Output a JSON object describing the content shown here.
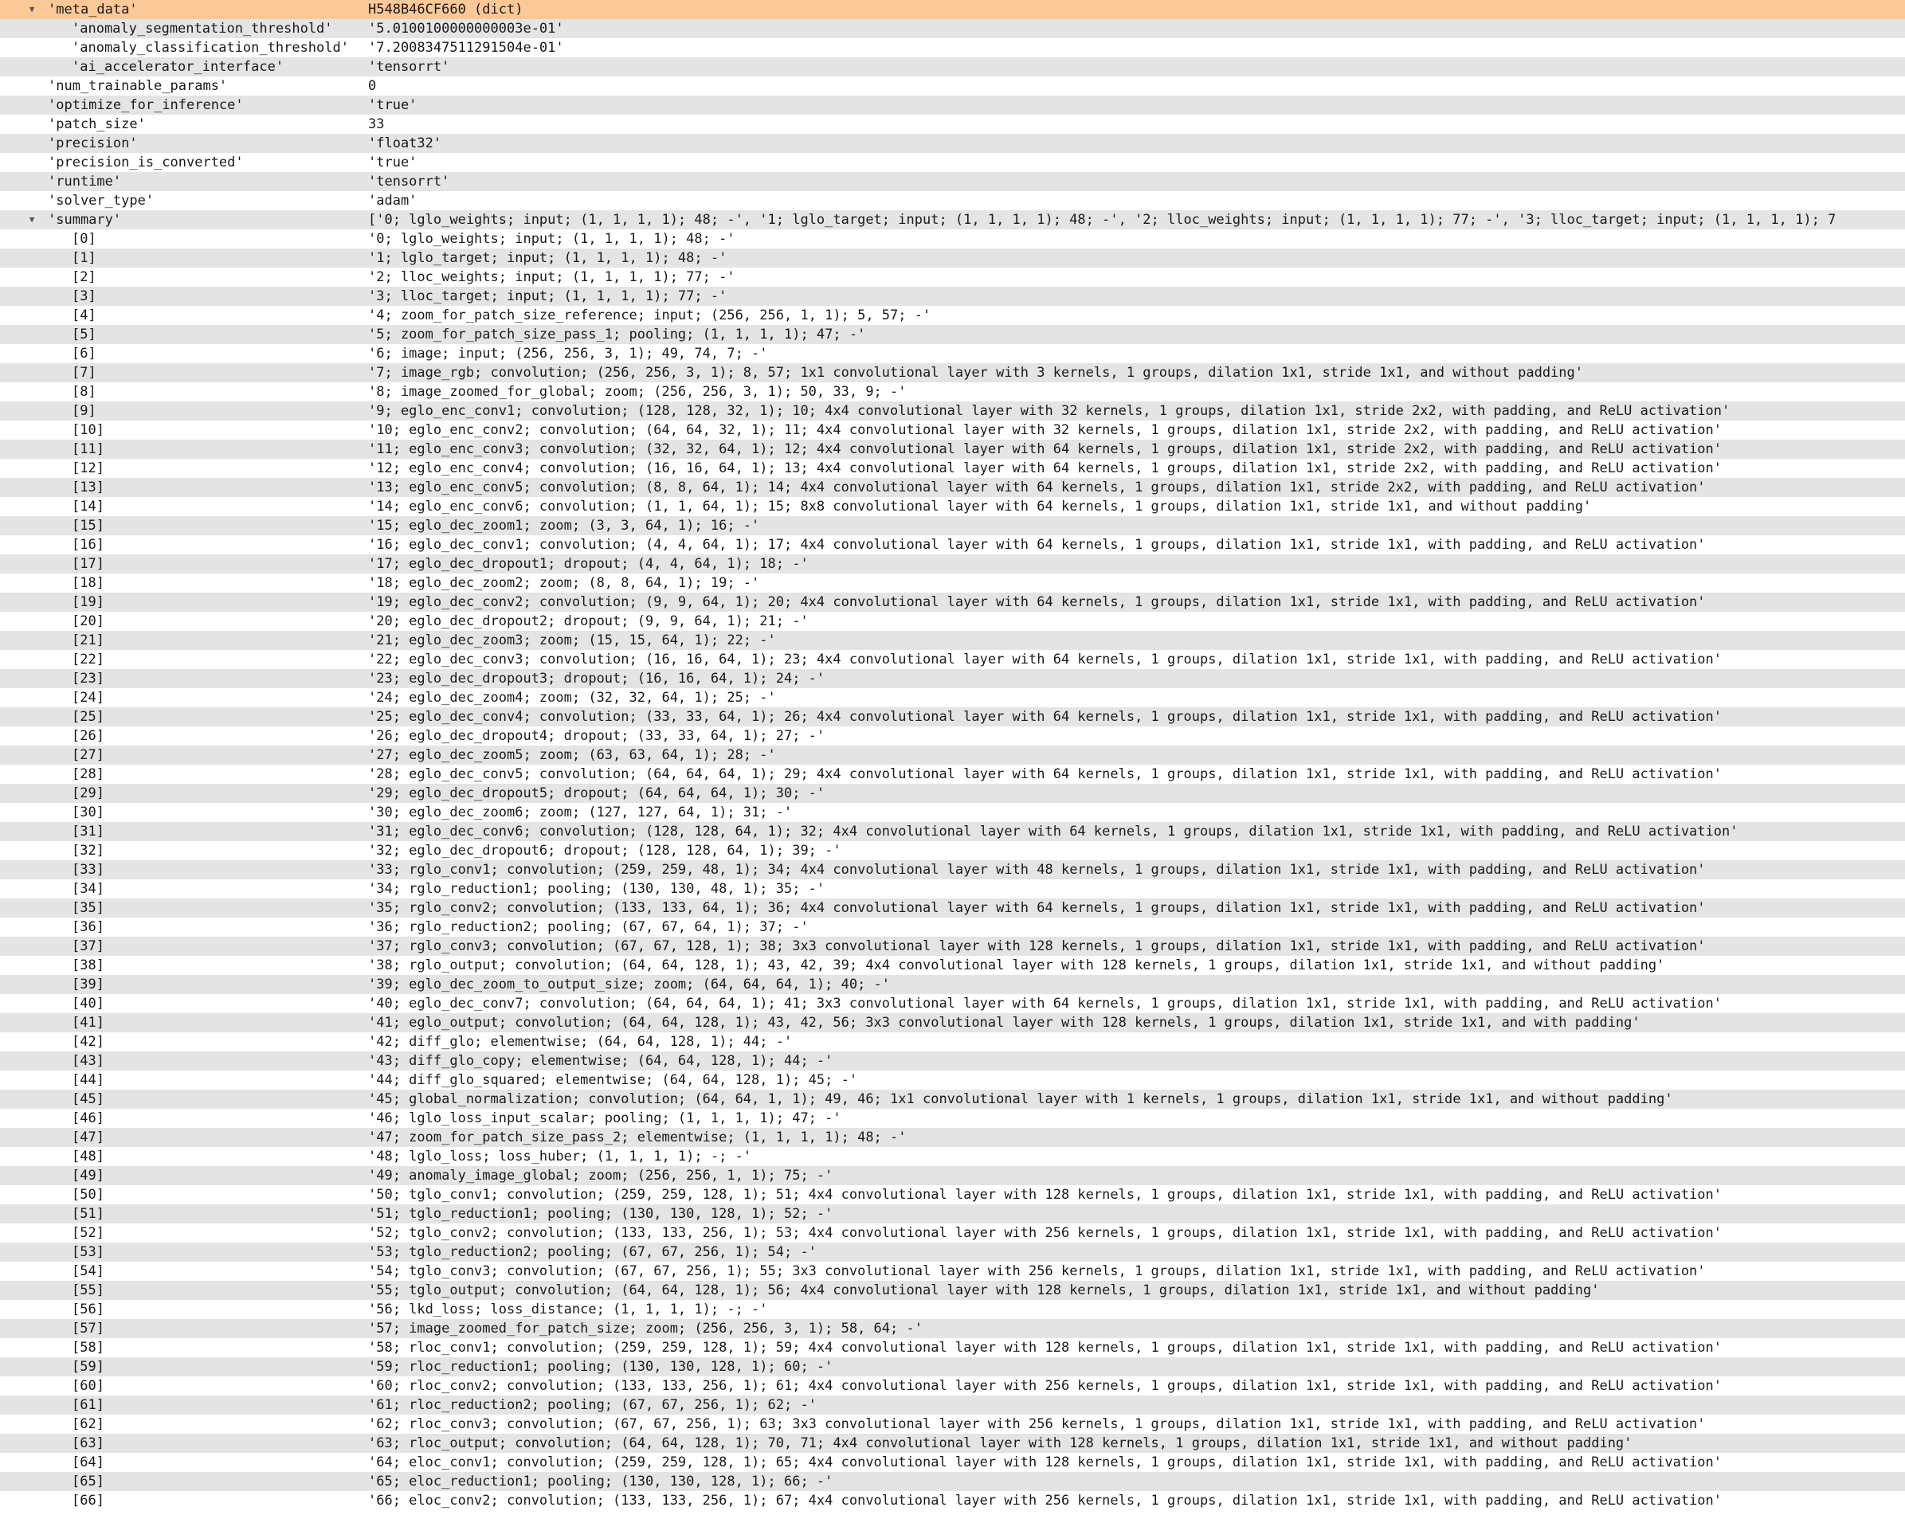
{
  "tree": {
    "rows": [
      {
        "key": "'meta_data'",
        "value": "H548B46CF660 (dict)",
        "depth": 0,
        "toggle": "expanded",
        "selected": true
      },
      {
        "key": "'anomaly_segmentation_threshold'",
        "value": "'5.0100100000000003e-01'",
        "depth": 1
      },
      {
        "key": "'anomaly_classification_threshold'",
        "value": "'7.2008347511291504e-01'",
        "depth": 1
      },
      {
        "key": "'ai_accelerator_interface'",
        "value": "'tensorrt'",
        "depth": 1
      },
      {
        "key": "'num_trainable_params'",
        "value": "0",
        "depth": 0
      },
      {
        "key": "'optimize_for_inference'",
        "value": "'true'",
        "depth": 0
      },
      {
        "key": "'patch_size'",
        "value": "33",
        "depth": 0
      },
      {
        "key": "'precision'",
        "value": "'float32'",
        "depth": 0
      },
      {
        "key": "'precision_is_converted'",
        "value": "'true'",
        "depth": 0
      },
      {
        "key": "'runtime'",
        "value": "'tensorrt'",
        "depth": 0
      },
      {
        "key": "'solver_type'",
        "value": "'adam'",
        "depth": 0
      },
      {
        "key": "'summary'",
        "value": "['0; lglo_weights; input; (1, 1, 1, 1); 48; -', '1; lglo_target; input; (1, 1, 1, 1); 48; -', '2; lloc_weights; input; (1, 1, 1, 1); 77; -', '3; lloc_target; input; (1, 1, 1, 1); 7",
        "depth": 0,
        "toggle": "expanded"
      },
      {
        "key": "[0]",
        "value": "'0; lglo_weights; input; (1, 1, 1, 1); 48; -'",
        "depth": 2
      },
      {
        "key": "[1]",
        "value": "'1; lglo_target; input; (1, 1, 1, 1); 48; -'",
        "depth": 2
      },
      {
        "key": "[2]",
        "value": "'2; lloc_weights; input; (1, 1, 1, 1); 77; -'",
        "depth": 2
      },
      {
        "key": "[3]",
        "value": "'3; lloc_target; input; (1, 1, 1, 1); 77; -'",
        "depth": 2
      },
      {
        "key": "[4]",
        "value": "'4; zoom_for_patch_size_reference; input; (256, 256, 1, 1); 5, 57; -'",
        "depth": 2
      },
      {
        "key": "[5]",
        "value": "'5; zoom_for_patch_size_pass_1; pooling; (1, 1, 1, 1); 47; -'",
        "depth": 2
      },
      {
        "key": "[6]",
        "value": "'6; image; input; (256, 256, 3, 1); 49, 74, 7; -'",
        "depth": 2
      },
      {
        "key": "[7]",
        "value": "'7; image_rgb; convolution; (256, 256, 3, 1); 8, 57; 1x1 convolutional layer with 3 kernels, 1 groups, dilation 1x1, stride 1x1, and without padding'",
        "depth": 2
      },
      {
        "key": "[8]",
        "value": "'8; image_zoomed_for_global; zoom; (256, 256, 3, 1); 50, 33, 9; -'",
        "depth": 2
      },
      {
        "key": "[9]",
        "value": "'9; eglo_enc_conv1; convolution; (128, 128, 32, 1); 10; 4x4 convolutional layer with 32 kernels, 1 groups, dilation 1x1, stride 2x2, with padding, and ReLU activation'",
        "depth": 2
      },
      {
        "key": "[10]",
        "value": "'10; eglo_enc_conv2; convolution; (64, 64, 32, 1); 11; 4x4 convolutional layer with 32 kernels, 1 groups, dilation 1x1, stride 2x2, with padding, and ReLU activation'",
        "depth": 2
      },
      {
        "key": "[11]",
        "value": "'11; eglo_enc_conv3; convolution; (32, 32, 64, 1); 12; 4x4 convolutional layer with 64 kernels, 1 groups, dilation 1x1, stride 2x2, with padding, and ReLU activation'",
        "depth": 2
      },
      {
        "key": "[12]",
        "value": "'12; eglo_enc_conv4; convolution; (16, 16, 64, 1); 13; 4x4 convolutional layer with 64 kernels, 1 groups, dilation 1x1, stride 2x2, with padding, and ReLU activation'",
        "depth": 2
      },
      {
        "key": "[13]",
        "value": "'13; eglo_enc_conv5; convolution; (8, 8, 64, 1); 14; 4x4 convolutional layer with 64 kernels, 1 groups, dilation 1x1, stride 2x2, with padding, and ReLU activation'",
        "depth": 2
      },
      {
        "key": "[14]",
        "value": "'14; eglo_enc_conv6; convolution; (1, 1, 64, 1); 15; 8x8 convolutional layer with 64 kernels, 1 groups, dilation 1x1, stride 1x1, and without padding'",
        "depth": 2
      },
      {
        "key": "[15]",
        "value": "'15; eglo_dec_zoom1; zoom; (3, 3, 64, 1); 16; -'",
        "depth": 2
      },
      {
        "key": "[16]",
        "value": "'16; eglo_dec_conv1; convolution; (4, 4, 64, 1); 17; 4x4 convolutional layer with 64 kernels, 1 groups, dilation 1x1, stride 1x1, with padding, and ReLU activation'",
        "depth": 2
      },
      {
        "key": "[17]",
        "value": "'17; eglo_dec_dropout1; dropout; (4, 4, 64, 1); 18; -'",
        "depth": 2
      },
      {
        "key": "[18]",
        "value": "'18; eglo_dec_zoom2; zoom; (8, 8, 64, 1); 19; -'",
        "depth": 2
      },
      {
        "key": "[19]",
        "value": "'19; eglo_dec_conv2; convolution; (9, 9, 64, 1); 20; 4x4 convolutional layer with 64 kernels, 1 groups, dilation 1x1, stride 1x1, with padding, and ReLU activation'",
        "depth": 2
      },
      {
        "key": "[20]",
        "value": "'20; eglo_dec_dropout2; dropout; (9, 9, 64, 1); 21; -'",
        "depth": 2
      },
      {
        "key": "[21]",
        "value": "'21; eglo_dec_zoom3; zoom; (15, 15, 64, 1); 22; -'",
        "depth": 2
      },
      {
        "key": "[22]",
        "value": "'22; eglo_dec_conv3; convolution; (16, 16, 64, 1); 23; 4x4 convolutional layer with 64 kernels, 1 groups, dilation 1x1, stride 1x1, with padding, and ReLU activation'",
        "depth": 2
      },
      {
        "key": "[23]",
        "value": "'23; eglo_dec_dropout3; dropout; (16, 16, 64, 1); 24; -'",
        "depth": 2
      },
      {
        "key": "[24]",
        "value": "'24; eglo_dec_zoom4; zoom; (32, 32, 64, 1); 25; -'",
        "depth": 2
      },
      {
        "key": "[25]",
        "value": "'25; eglo_dec_conv4; convolution; (33, 33, 64, 1); 26; 4x4 convolutional layer with 64 kernels, 1 groups, dilation 1x1, stride 1x1, with padding, and ReLU activation'",
        "depth": 2
      },
      {
        "key": "[26]",
        "value": "'26; eglo_dec_dropout4; dropout; (33, 33, 64, 1); 27; -'",
        "depth": 2
      },
      {
        "key": "[27]",
        "value": "'27; eglo_dec_zoom5; zoom; (63, 63, 64, 1); 28; -'",
        "depth": 2
      },
      {
        "key": "[28]",
        "value": "'28; eglo_dec_conv5; convolution; (64, 64, 64, 1); 29; 4x4 convolutional layer with 64 kernels, 1 groups, dilation 1x1, stride 1x1, with padding, and ReLU activation'",
        "depth": 2
      },
      {
        "key": "[29]",
        "value": "'29; eglo_dec_dropout5; dropout; (64, 64, 64, 1); 30; -'",
        "depth": 2
      },
      {
        "key": "[30]",
        "value": "'30; eglo_dec_zoom6; zoom; (127, 127, 64, 1); 31; -'",
        "depth": 2
      },
      {
        "key": "[31]",
        "value": "'31; eglo_dec_conv6; convolution; (128, 128, 64, 1); 32; 4x4 convolutional layer with 64 kernels, 1 groups, dilation 1x1, stride 1x1, with padding, and ReLU activation'",
        "depth": 2
      },
      {
        "key": "[32]",
        "value": "'32; eglo_dec_dropout6; dropout; (128, 128, 64, 1); 39; -'",
        "depth": 2
      },
      {
        "key": "[33]",
        "value": "'33; rglo_conv1; convolution; (259, 259, 48, 1); 34; 4x4 convolutional layer with 48 kernels, 1 groups, dilation 1x1, stride 1x1, with padding, and ReLU activation'",
        "depth": 2
      },
      {
        "key": "[34]",
        "value": "'34; rglo_reduction1; pooling; (130, 130, 48, 1); 35; -'",
        "depth": 2
      },
      {
        "key": "[35]",
        "value": "'35; rglo_conv2; convolution; (133, 133, 64, 1); 36; 4x4 convolutional layer with 64 kernels, 1 groups, dilation 1x1, stride 1x1, with padding, and ReLU activation'",
        "depth": 2
      },
      {
        "key": "[36]",
        "value": "'36; rglo_reduction2; pooling; (67, 67, 64, 1); 37; -'",
        "depth": 2
      },
      {
        "key": "[37]",
        "value": "'37; rglo_conv3; convolution; (67, 67, 128, 1); 38; 3x3 convolutional layer with 128 kernels, 1 groups, dilation 1x1, stride 1x1, with padding, and ReLU activation'",
        "depth": 2
      },
      {
        "key": "[38]",
        "value": "'38; rglo_output; convolution; (64, 64, 128, 1); 43, 42, 39; 4x4 convolutional layer with 128 kernels, 1 groups, dilation 1x1, stride 1x1, and without padding'",
        "depth": 2
      },
      {
        "key": "[39]",
        "value": "'39; eglo_dec_zoom_to_output_size; zoom; (64, 64, 64, 1); 40; -'",
        "depth": 2
      },
      {
        "key": "[40]",
        "value": "'40; eglo_dec_conv7; convolution; (64, 64, 64, 1); 41; 3x3 convolutional layer with 64 kernels, 1 groups, dilation 1x1, stride 1x1, with padding, and ReLU activation'",
        "depth": 2
      },
      {
        "key": "[41]",
        "value": "'41; eglo_output; convolution; (64, 64, 128, 1); 43, 42, 56; 3x3 convolutional layer with 128 kernels, 1 groups, dilation 1x1, stride 1x1, and with padding'",
        "depth": 2
      },
      {
        "key": "[42]",
        "value": "'42; diff_glo; elementwise; (64, 64, 128, 1); 44; -'",
        "depth": 2
      },
      {
        "key": "[43]",
        "value": "'43; diff_glo_copy; elementwise; (64, 64, 128, 1); 44; -'",
        "depth": 2
      },
      {
        "key": "[44]",
        "value": "'44; diff_glo_squared; elementwise; (64, 64, 128, 1); 45; -'",
        "depth": 2
      },
      {
        "key": "[45]",
        "value": "'45; global_normalization; convolution; (64, 64, 1, 1); 49, 46; 1x1 convolutional layer with 1 kernels, 1 groups, dilation 1x1, stride 1x1, and without padding'",
        "depth": 2
      },
      {
        "key": "[46]",
        "value": "'46; lglo_loss_input_scalar; pooling; (1, 1, 1, 1); 47; -'",
        "depth": 2
      },
      {
        "key": "[47]",
        "value": "'47; zoom_for_patch_size_pass_2; elementwise; (1, 1, 1, 1); 48; -'",
        "depth": 2
      },
      {
        "key": "[48]",
        "value": "'48; lglo_loss; loss_huber; (1, 1, 1, 1); -; -'",
        "depth": 2
      },
      {
        "key": "[49]",
        "value": "'49; anomaly_image_global; zoom; (256, 256, 1, 1); 75; -'",
        "depth": 2
      },
      {
        "key": "[50]",
        "value": "'50; tglo_conv1; convolution; (259, 259, 128, 1); 51; 4x4 convolutional layer with 128 kernels, 1 groups, dilation 1x1, stride 1x1, with padding, and ReLU activation'",
        "depth": 2
      },
      {
        "key": "[51]",
        "value": "'51; tglo_reduction1; pooling; (130, 130, 128, 1); 52; -'",
        "depth": 2
      },
      {
        "key": "[52]",
        "value": "'52; tglo_conv2; convolution; (133, 133, 256, 1); 53; 4x4 convolutional layer with 256 kernels, 1 groups, dilation 1x1, stride 1x1, with padding, and ReLU activation'",
        "depth": 2
      },
      {
        "key": "[53]",
        "value": "'53; tglo_reduction2; pooling; (67, 67, 256, 1); 54; -'",
        "depth": 2
      },
      {
        "key": "[54]",
        "value": "'54; tglo_conv3; convolution; (67, 67, 256, 1); 55; 3x3 convolutional layer with 256 kernels, 1 groups, dilation 1x1, stride 1x1, with padding, and ReLU activation'",
        "depth": 2
      },
      {
        "key": "[55]",
        "value": "'55; tglo_output; convolution; (64, 64, 128, 1); 56; 4x4 convolutional layer with 128 kernels, 1 groups, dilation 1x1, stride 1x1, and without padding'",
        "depth": 2
      },
      {
        "key": "[56]",
        "value": "'56; lkd_loss; loss_distance; (1, 1, 1, 1); -; -'",
        "depth": 2
      },
      {
        "key": "[57]",
        "value": "'57; image_zoomed_for_patch_size; zoom; (256, 256, 3, 1); 58, 64; -'",
        "depth": 2
      },
      {
        "key": "[58]",
        "value": "'58; rloc_conv1; convolution; (259, 259, 128, 1); 59; 4x4 convolutional layer with 128 kernels, 1 groups, dilation 1x1, stride 1x1, with padding, and ReLU activation'",
        "depth": 2
      },
      {
        "key": "[59]",
        "value": "'59; rloc_reduction1; pooling; (130, 130, 128, 1); 60; -'",
        "depth": 2
      },
      {
        "key": "[60]",
        "value": "'60; rloc_conv2; convolution; (133, 133, 256, 1); 61; 4x4 convolutional layer with 256 kernels, 1 groups, dilation 1x1, stride 1x1, with padding, and ReLU activation'",
        "depth": 2
      },
      {
        "key": "[61]",
        "value": "'61; rloc_reduction2; pooling; (67, 67, 256, 1); 62; -'",
        "depth": 2
      },
      {
        "key": "[62]",
        "value": "'62; rloc_conv3; convolution; (67, 67, 256, 1); 63; 3x3 convolutional layer with 256 kernels, 1 groups, dilation 1x1, stride 1x1, with padding, and ReLU activation'",
        "depth": 2
      },
      {
        "key": "[63]",
        "value": "'63; rloc_output; convolution; (64, 64, 128, 1); 70, 71; 4x4 convolutional layer with 128 kernels, 1 groups, dilation 1x1, stride 1x1, and without padding'",
        "depth": 2
      },
      {
        "key": "[64]",
        "value": "'64; eloc_conv1; convolution; (259, 259, 128, 1); 65; 4x4 convolutional layer with 128 kernels, 1 groups, dilation 1x1, stride 1x1, with padding, and ReLU activation'",
        "depth": 2
      },
      {
        "key": "[65]",
        "value": "'65; eloc_reduction1; pooling; (130, 130, 128, 1); 66; -'",
        "depth": 2
      },
      {
        "key": "[66]",
        "value": "'66; eloc_conv2; convolution; (133, 133, 256, 1); 67; 4x4 convolutional layer with 256 kernels, 1 groups, dilation 1x1, stride 1x1, with padding, and ReLU activation'",
        "depth": 2
      }
    ]
  },
  "theme": {
    "selected_row_color": "#fbc897",
    "alternate_row_color": "#e4e4e4",
    "row_color": "#ffffff",
    "text_color": "#1a1a1a",
    "expanded_icon": "triangle-down-icon"
  }
}
